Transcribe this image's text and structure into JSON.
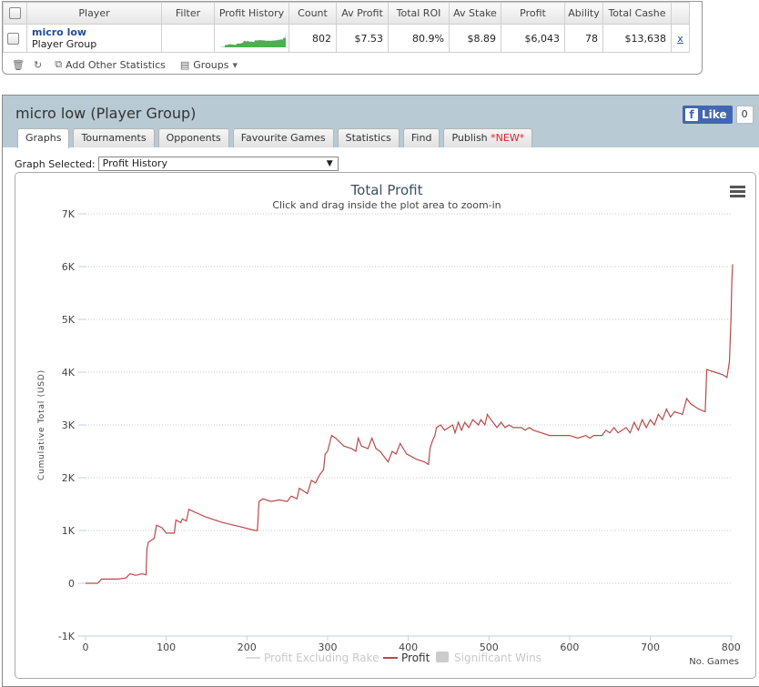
{
  "stats_table": {
    "headers": [
      "Player",
      "Filter",
      "Profit History",
      "Count",
      "Av Profit",
      "Total ROI",
      "Av Stake",
      "Profit",
      "Ability",
      "Total Cashe"
    ],
    "row": {
      "player_name": "micro low",
      "player_type": "Player Group",
      "filter": "",
      "count": "802",
      "av_profit": "$7.53",
      "total_roi": "80.9%",
      "av_stake": "$8.89",
      "profit": "$6,043",
      "ability": "78",
      "total_cashes": "$13,638",
      "remove": "x"
    },
    "toolbar": {
      "add_stats": "Add Other Statistics",
      "groups": "Groups"
    },
    "sparkline_color": "#4caf50"
  },
  "panel": {
    "title": "micro low (Player Group)",
    "like_label": "Like",
    "like_count": "0",
    "tabs": [
      "Graphs",
      "Tournaments",
      "Opponents",
      "Favourite Games",
      "Statistics",
      "Find",
      "Publish"
    ],
    "publish_badge": "*NEW*",
    "active_tab": "Graphs",
    "graph_select_label": "Graph Selected:",
    "graph_select_value": "Profit History"
  },
  "chart_data": {
    "type": "line",
    "title": "Total Profit",
    "subtitle": "Click and drag inside the plot area to zoom-in",
    "xlabel": "No. Games",
    "ylabel": "Cumulative Total (USD)",
    "xlim": [
      0,
      802
    ],
    "ylim": [
      -1000,
      7000
    ],
    "xticks": [
      0,
      100,
      200,
      300,
      400,
      500,
      600,
      700,
      800
    ],
    "yticks": [
      -1000,
      0,
      1000,
      2000,
      3000,
      4000,
      5000,
      6000,
      7000
    ],
    "ytick_labels": [
      "-1K",
      "0",
      "1K",
      "2K",
      "3K",
      "4K",
      "5K",
      "6K",
      "7K"
    ],
    "grid": true,
    "line_color": "#b94a48",
    "legend": [
      {
        "name": "Profit Excluding Rake",
        "color": "#dddddd",
        "kind": "line"
      },
      {
        "name": "Profit",
        "color": "#b94a48",
        "kind": "line"
      },
      {
        "name": "Significant Wins",
        "color": "#cccccc",
        "kind": "box"
      }
    ],
    "series": [
      {
        "name": "Profit",
        "points": [
          [
            0,
            0
          ],
          [
            15,
            0
          ],
          [
            20,
            80
          ],
          [
            40,
            80
          ],
          [
            50,
            100
          ],
          [
            55,
            180
          ],
          [
            62,
            150
          ],
          [
            70,
            180
          ],
          [
            75,
            160
          ],
          [
            76,
            650
          ],
          [
            78,
            780
          ],
          [
            80,
            800
          ],
          [
            85,
            850
          ],
          [
            88,
            1100
          ],
          [
            95,
            1050
          ],
          [
            100,
            950
          ],
          [
            110,
            950
          ],
          [
            112,
            1200
          ],
          [
            118,
            1150
          ],
          [
            120,
            1220
          ],
          [
            125,
            1180
          ],
          [
            128,
            1400
          ],
          [
            135,
            1350
          ],
          [
            150,
            1250
          ],
          [
            170,
            1150
          ],
          [
            190,
            1080
          ],
          [
            210,
            1000
          ],
          [
            213,
            1000
          ],
          [
            215,
            1550
          ],
          [
            220,
            1600
          ],
          [
            230,
            1550
          ],
          [
            240,
            1580
          ],
          [
            250,
            1550
          ],
          [
            255,
            1650
          ],
          [
            262,
            1600
          ],
          [
            265,
            1800
          ],
          [
            270,
            1750
          ],
          [
            275,
            1700
          ],
          [
            280,
            1950
          ],
          [
            285,
            1900
          ],
          [
            290,
            2050
          ],
          [
            295,
            2150
          ],
          [
            297,
            2450
          ],
          [
            300,
            2500
          ],
          [
            305,
            2800
          ],
          [
            310,
            2750
          ],
          [
            320,
            2600
          ],
          [
            330,
            2550
          ],
          [
            335,
            2500
          ],
          [
            338,
            2750
          ],
          [
            342,
            2600
          ],
          [
            350,
            2550
          ],
          [
            355,
            2750
          ],
          [
            360,
            2550
          ],
          [
            365,
            2500
          ],
          [
            370,
            2400
          ],
          [
            375,
            2300
          ],
          [
            380,
            2500
          ],
          [
            385,
            2450
          ],
          [
            390,
            2650
          ],
          [
            398,
            2450
          ],
          [
            410,
            2350
          ],
          [
            420,
            2300
          ],
          [
            425,
            2250
          ],
          [
            427,
            2550
          ],
          [
            430,
            2700
          ],
          [
            433,
            2800
          ],
          [
            435,
            2950
          ],
          [
            440,
            3000
          ],
          [
            445,
            2900
          ],
          [
            450,
            2950
          ],
          [
            455,
            3000
          ],
          [
            458,
            2850
          ],
          [
            462,
            3050
          ],
          [
            466,
            2900
          ],
          [
            470,
            3050
          ],
          [
            475,
            2950
          ],
          [
            480,
            3100
          ],
          [
            487,
            3000
          ],
          [
            490,
            3100
          ],
          [
            495,
            3000
          ],
          [
            498,
            3200
          ],
          [
            500,
            3150
          ],
          [
            505,
            3050
          ],
          [
            510,
            2950
          ],
          [
            515,
            3050
          ],
          [
            520,
            2950
          ],
          [
            525,
            3000
          ],
          [
            530,
            2950
          ],
          [
            540,
            2950
          ],
          [
            545,
            2900
          ],
          [
            550,
            2950
          ],
          [
            555,
            2900
          ],
          [
            565,
            2850
          ],
          [
            575,
            2800
          ],
          [
            590,
            2800
          ],
          [
            600,
            2800
          ],
          [
            610,
            2750
          ],
          [
            620,
            2800
          ],
          [
            625,
            2750
          ],
          [
            630,
            2800
          ],
          [
            640,
            2800
          ],
          [
            645,
            2900
          ],
          [
            650,
            2850
          ],
          [
            655,
            2950
          ],
          [
            660,
            2850
          ],
          [
            670,
            2950
          ],
          [
            675,
            2850
          ],
          [
            680,
            3050
          ],
          [
            685,
            2900
          ],
          [
            690,
            3100
          ],
          [
            695,
            2950
          ],
          [
            700,
            3100
          ],
          [
            705,
            3000
          ],
          [
            710,
            3200
          ],
          [
            715,
            3100
          ],
          [
            720,
            3300
          ],
          [
            725,
            3150
          ],
          [
            730,
            3250
          ],
          [
            740,
            3200
          ],
          [
            745,
            3500
          ],
          [
            750,
            3400
          ],
          [
            760,
            3300
          ],
          [
            768,
            3250
          ],
          [
            770,
            4050
          ],
          [
            780,
            4000
          ],
          [
            790,
            3950
          ],
          [
            795,
            3900
          ],
          [
            798,
            4200
          ],
          [
            800,
            5000
          ],
          [
            801,
            5700
          ],
          [
            802,
            6043
          ]
        ]
      }
    ]
  }
}
